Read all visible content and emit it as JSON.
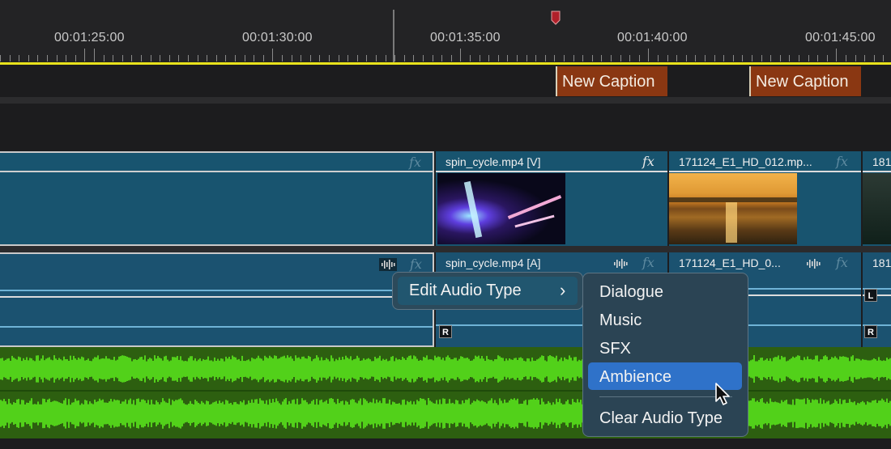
{
  "timeline": {
    "timecodes": [
      "00:01:25:00",
      "00:01:30:00",
      "00:01:35:00",
      "00:01:40:00",
      "00:01:45:00"
    ]
  },
  "captions": [
    {
      "label": "New Caption"
    },
    {
      "label": "New Caption"
    }
  ],
  "video_clips": [
    {
      "name": "",
      "fx": "fx"
    },
    {
      "name": "spin_cycle.mp4 [V]",
      "fx": "fx"
    },
    {
      "name": "171124_E1_HD_012.mp...",
      "fx": "fx"
    },
    {
      "name": "181",
      "fx": ""
    }
  ],
  "audio_clips": [
    {
      "name": "",
      "fx": "fx"
    },
    {
      "name": "spin_cycle.mp4 [A]",
      "fx": "fx"
    },
    {
      "name": "171124_E1_HD_0...",
      "fx": "fx"
    },
    {
      "name": "181",
      "fx": ""
    }
  ],
  "channel_badges": {
    "left": "L",
    "right": "R"
  },
  "context_menu": {
    "parent_item": "Edit Audio Type",
    "chevron": "›",
    "submenu": {
      "items": [
        "Dialogue",
        "Music",
        "SFX",
        "Ambience"
      ],
      "selected": "Ambience",
      "clear": "Clear Audio Type"
    }
  },
  "colors": {
    "caption": "#8a3712",
    "video_clip": "#18546f",
    "audio_clip": "#1b5270",
    "waveform": "#52d11a",
    "selected_item": "#2f72c9",
    "ruler_line": "#e8e21c"
  }
}
